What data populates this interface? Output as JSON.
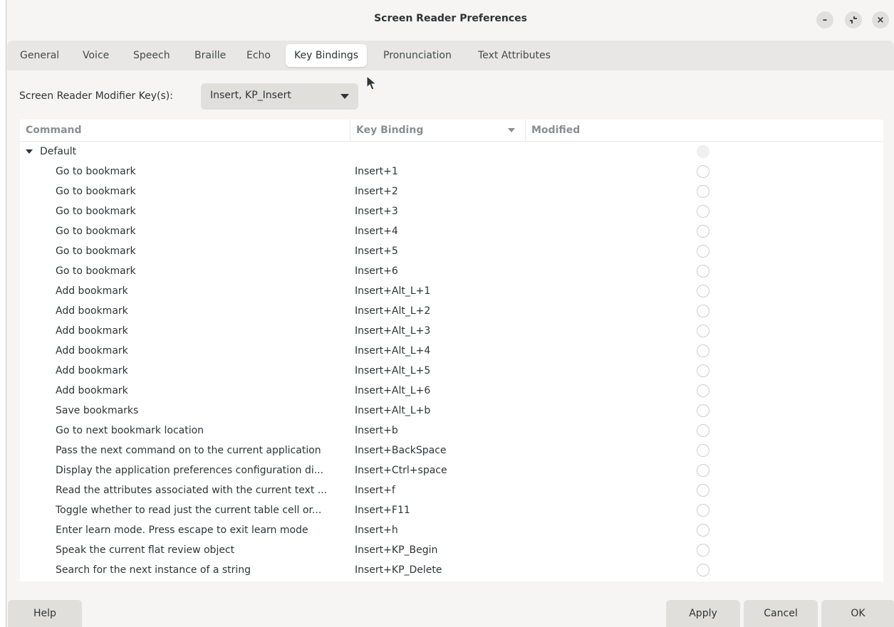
{
  "window": {
    "title": "Screen Reader Preferences",
    "controls": {
      "minimize": "–",
      "restore": "⤡",
      "close": "×"
    }
  },
  "tabs": [
    {
      "label": "General"
    },
    {
      "label": "Voice"
    },
    {
      "label": "Speech"
    },
    {
      "label": "Braille"
    },
    {
      "label": "Echo"
    },
    {
      "label": "Key Bindings",
      "active": true
    },
    {
      "label": "Pronunciation"
    },
    {
      "label": "Text Attributes"
    }
  ],
  "modifier": {
    "label": "Screen Reader Modifier Key(s):",
    "selected": "Insert, KP_Insert"
  },
  "table": {
    "columns": [
      "Command",
      "Key Binding",
      "Modified"
    ],
    "group": "Default",
    "rows": [
      {
        "command": "Go to bookmark",
        "binding": "Insert+1"
      },
      {
        "command": "Go to bookmark",
        "binding": "Insert+2"
      },
      {
        "command": "Go to bookmark",
        "binding": "Insert+3"
      },
      {
        "command": "Go to bookmark",
        "binding": "Insert+4"
      },
      {
        "command": "Go to bookmark",
        "binding": "Insert+5"
      },
      {
        "command": "Go to bookmark",
        "binding": "Insert+6"
      },
      {
        "command": "Add bookmark",
        "binding": "Insert+Alt_L+1"
      },
      {
        "command": "Add bookmark",
        "binding": "Insert+Alt_L+2"
      },
      {
        "command": "Add bookmark",
        "binding": "Insert+Alt_L+3"
      },
      {
        "command": "Add bookmark",
        "binding": "Insert+Alt_L+4"
      },
      {
        "command": "Add bookmark",
        "binding": "Insert+Alt_L+5"
      },
      {
        "command": "Add bookmark",
        "binding": "Insert+Alt_L+6"
      },
      {
        "command": "Save bookmarks",
        "binding": "Insert+Alt_L+b"
      },
      {
        "command": "Go to next bookmark location",
        "binding": "Insert+b"
      },
      {
        "command": "Pass the next command on to the current application",
        "binding": "Insert+BackSpace"
      },
      {
        "command": "Display the application preferences configuration di...",
        "binding": "Insert+Ctrl+space"
      },
      {
        "command": "Read the attributes associated with the current text ...",
        "binding": "Insert+f"
      },
      {
        "command": "Toggle whether to read just the current table cell or...",
        "binding": "Insert+F11"
      },
      {
        "command": "Enter learn mode.  Press escape to exit learn mode",
        "binding": "Insert+h"
      },
      {
        "command": "Speak the current flat review object",
        "binding": "Insert+KP_Begin"
      },
      {
        "command": "Search for the next instance of a string",
        "binding": "Insert+KP_Delete"
      }
    ]
  },
  "buttons": {
    "help": "Help",
    "apply": "Apply",
    "cancel": "Cancel",
    "ok": "OK"
  }
}
